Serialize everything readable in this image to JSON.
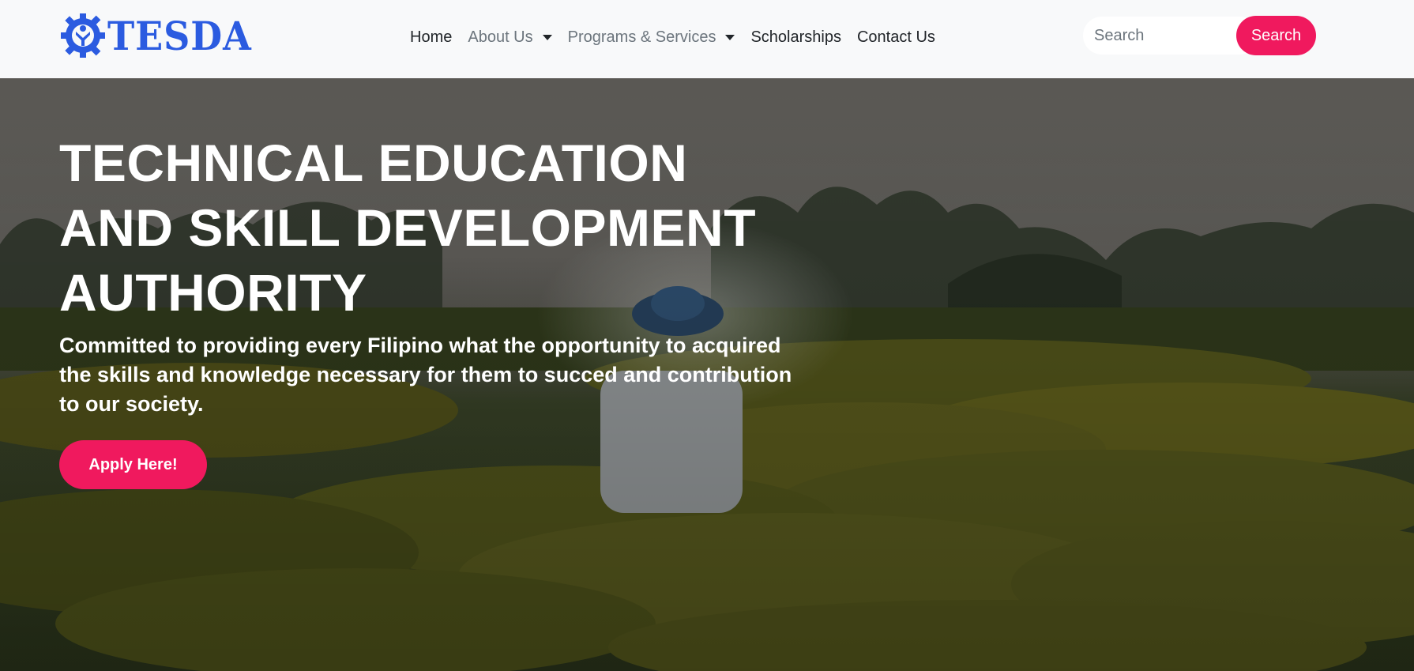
{
  "brand": {
    "name": "TESDA",
    "logo_icon": "tesda-gear-logo-icon",
    "color": "#2b5be0"
  },
  "nav": {
    "items": [
      {
        "label": "Home",
        "dropdown": false,
        "muted": false
      },
      {
        "label": "About Us",
        "dropdown": true,
        "muted": true
      },
      {
        "label": "Programs & Services",
        "dropdown": true,
        "muted": true
      },
      {
        "label": "Scholarships",
        "dropdown": false,
        "muted": false
      },
      {
        "label": "Contact Us",
        "dropdown": false,
        "muted": false
      }
    ]
  },
  "search": {
    "placeholder": "Search",
    "value": "",
    "button_label": "Search"
  },
  "hero": {
    "title": "TECHNICAL EDUCATION AND SKILL DEVELOPMENT AUTHORITY",
    "subtitle": "Committed to providing every Filipino what the opportunity to acquired the skills and knowledge necessary for them to succed and contribution to our society.",
    "cta_label": "Apply Here!"
  },
  "colors": {
    "accent": "#f0195e",
    "navbar_bg": "#f8f9fa"
  }
}
